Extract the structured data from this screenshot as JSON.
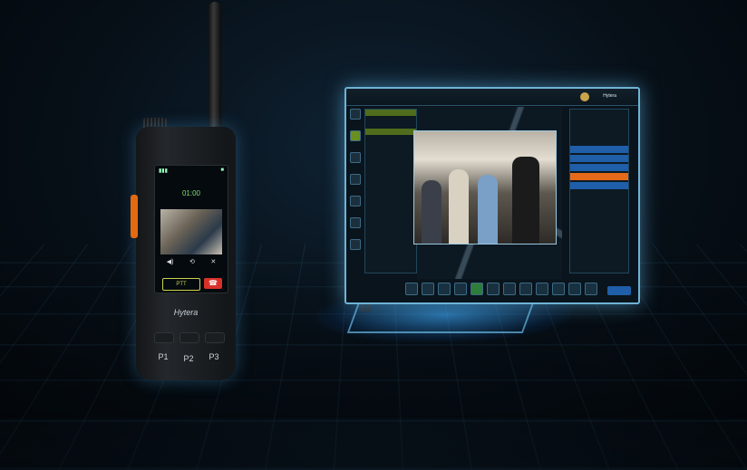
{
  "scene": {
    "description": ""
  },
  "radio": {
    "brand": "Hytera",
    "timer": "01:00",
    "ptt_label": "PTT",
    "keys": [
      "P1",
      "P2",
      "P3"
    ]
  },
  "monitor": {
    "user": "Hytera"
  }
}
